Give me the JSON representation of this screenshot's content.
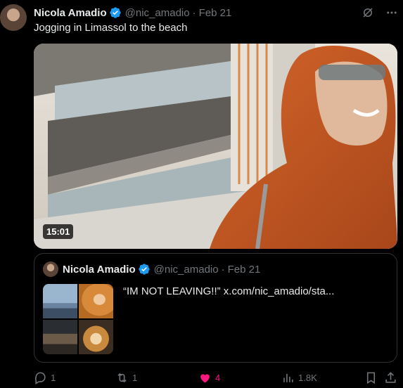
{
  "tweet": {
    "author_name": "Nicola Amadio",
    "handle": "@nic_amadio",
    "separator": "·",
    "date": "Feb 21",
    "text": "Jogging in Limassol to the beach",
    "video_duration": "15:01"
  },
  "quote": {
    "author_name": "Nicola Amadio",
    "handle": "@nic_amadio",
    "separator": "·",
    "date": "Feb 21",
    "text": "“IM NOT LEAVING!!”  x.com/nic_amadio/sta..."
  },
  "actions": {
    "replies": "1",
    "reposts": "1",
    "likes": "4",
    "views": "1.8K"
  },
  "colors": {
    "like_pink": "#f91880",
    "verified_blue": "#1d9bf0",
    "muted": "#71767b"
  },
  "icons": [
    "verified-icon",
    "grok-icon",
    "more-icon",
    "reply-icon",
    "repost-icon",
    "like-icon",
    "views-icon",
    "bookmark-icon",
    "share-icon"
  ]
}
